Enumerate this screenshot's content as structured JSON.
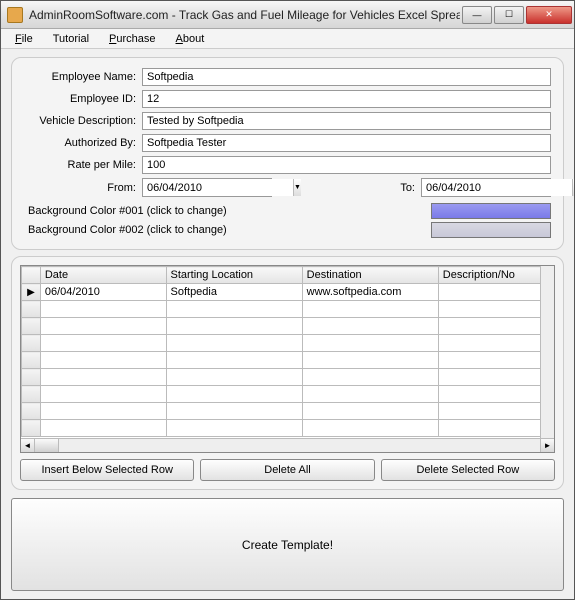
{
  "window": {
    "title": "AdminRoomSoftware.com - Track Gas and Fuel Mileage  for Vehicles Excel Spreadsheet"
  },
  "menu": {
    "file": "File",
    "tutorial": "Tutorial",
    "purchase": "Purchase",
    "about": "About"
  },
  "form": {
    "labels": {
      "employee_name": "Employee Name:",
      "employee_id": "Employee ID:",
      "vehicle_description": "Vehicle Description:",
      "authorized_by": "Authorized By:",
      "rate_per_mile": "Rate per Mile:",
      "from": "From:",
      "to": "To:"
    },
    "values": {
      "employee_name": "Softpedia",
      "employee_id": "12",
      "vehicle_description": "Tested by Softpedia",
      "authorized_by": "Softpedia Tester",
      "rate_per_mile": "100",
      "from": "06/04/2010",
      "to": "06/04/2010"
    },
    "color1_label": "Background Color #001 (click to change)",
    "color2_label": "Background Color #002 (click to change)",
    "color1": "#8585eb",
    "color2": "#cfcfde"
  },
  "grid": {
    "headers": [
      "Date",
      "Starting Location",
      "Destination",
      "Description/No"
    ],
    "col_widths": [
      "120px",
      "130px",
      "130px",
      "110px"
    ],
    "rows": [
      {
        "row_marker": "▶",
        "cells": [
          "06/04/2010",
          "Softpedia",
          "www.softpedia.com",
          ""
        ]
      },
      {
        "row_marker": "",
        "cells": [
          "",
          "",
          "",
          ""
        ]
      },
      {
        "row_marker": "",
        "cells": [
          "",
          "",
          "",
          ""
        ]
      },
      {
        "row_marker": "",
        "cells": [
          "",
          "",
          "",
          ""
        ]
      },
      {
        "row_marker": "",
        "cells": [
          "",
          "",
          "",
          ""
        ]
      },
      {
        "row_marker": "",
        "cells": [
          "",
          "",
          "",
          ""
        ]
      },
      {
        "row_marker": "",
        "cells": [
          "",
          "",
          "",
          ""
        ]
      },
      {
        "row_marker": "",
        "cells": [
          "",
          "",
          "",
          ""
        ]
      },
      {
        "row_marker": "",
        "cells": [
          "",
          "",
          "",
          ""
        ]
      }
    ]
  },
  "buttons": {
    "insert": "Insert Below Selected Row",
    "delete_all": "Delete All",
    "delete_selected": "Delete Selected Row",
    "create": "Create Template!"
  }
}
